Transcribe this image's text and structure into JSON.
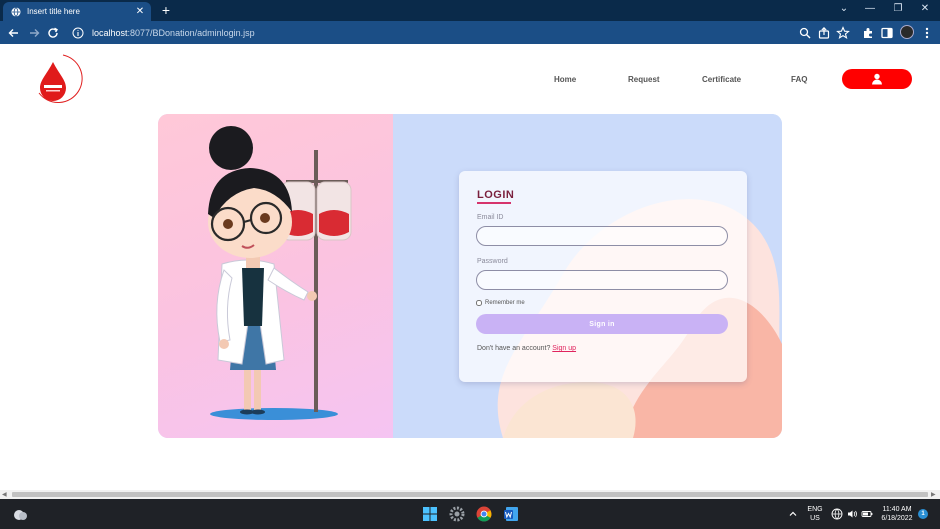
{
  "browser": {
    "tab_title": "Insert title here",
    "tab_close": "✕",
    "new_tab": "+",
    "window_controls": [
      "⌄",
      "—",
      "❐",
      "✕"
    ],
    "url_host": "localhost",
    "url_rest": ":8077/BDonation/adminlogin.jsp"
  },
  "site": {
    "nav": [
      "Home",
      "Request",
      "Certificate",
      "FAQ"
    ],
    "colors": {
      "accent": "#ff0000",
      "title": "#7a1f3c",
      "link": "#e0245e",
      "button": "#c9b2f5"
    }
  },
  "login": {
    "title": "LOGIN",
    "email_label": "Email ID",
    "email_value": "",
    "password_label": "Password",
    "password_value": "",
    "remember_label": "Remember me",
    "signin_label": "Sign in",
    "signup_prompt": "Don't have an account?",
    "signup_link": "Sign up"
  },
  "taskbar": {
    "lang_top": "ENG",
    "lang_bottom": "US",
    "time": "11:40 AM",
    "date": "6/18/2022",
    "notification_count": "1"
  }
}
